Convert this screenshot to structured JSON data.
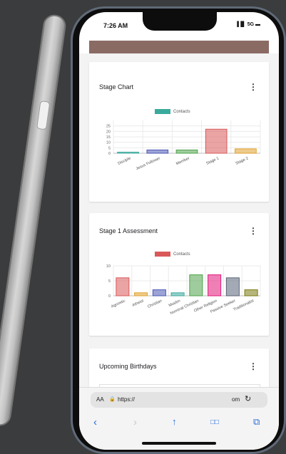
{
  "status": {
    "time": "7:26 AM",
    "icons": "▐▐▌ 5G ▬"
  },
  "stage_chart": {
    "title": "Stage Chart",
    "menu": "⋮",
    "legend": "Contacts",
    "legend_color": "#3aaa9c",
    "chart_data": {
      "type": "bar",
      "categories": [
        "Disciple",
        "Jesus Follower",
        "Member",
        "Stage 1",
        "Stage 2"
      ],
      "values": [
        1,
        3,
        3,
        22,
        4
      ],
      "ylim": [
        0,
        30
      ],
      "yticks": [
        "0",
        "5",
        "10",
        "15",
        "20",
        "25"
      ],
      "colors": [
        "#3aaa9c",
        "#4a57b5",
        "#4ea34a",
        "#d9595a",
        "#e0a02c"
      ]
    }
  },
  "assessment_chart": {
    "title": "Stage 1 Assessment",
    "menu": "⋮",
    "legend": "Contacts",
    "legend_color": "#d9595a",
    "chart_data": {
      "type": "bar",
      "categories": [
        "Agnostic",
        "Atheist",
        "Christian",
        "Muslim",
        "Nominal Christian",
        "Other Religion",
        "Passive Seeker",
        "Traditionalist"
      ],
      "values": [
        6,
        1,
        2,
        1,
        7,
        7,
        6,
        2
      ],
      "ylim": [
        0,
        10
      ],
      "yticks": [
        "0",
        "5",
        "10"
      ],
      "colors": [
        "#d9595a",
        "#e0a02c",
        "#4a57b5",
        "#3aaa9c",
        "#4ea34a",
        "#e0187a",
        "#5a6478",
        "#7a7a10",
        "#d4a07a"
      ]
    }
  },
  "birthdays": {
    "title": "Upcoming Birthdays",
    "menu": "⋮"
  },
  "browser": {
    "aa": "AA",
    "lock": "🔒",
    "url": "https://",
    "url_right": "om",
    "reload": "↻",
    "back": "‹",
    "forward": "›",
    "share": "↑",
    "bookmarks": "□□",
    "tabs": "⧉"
  }
}
